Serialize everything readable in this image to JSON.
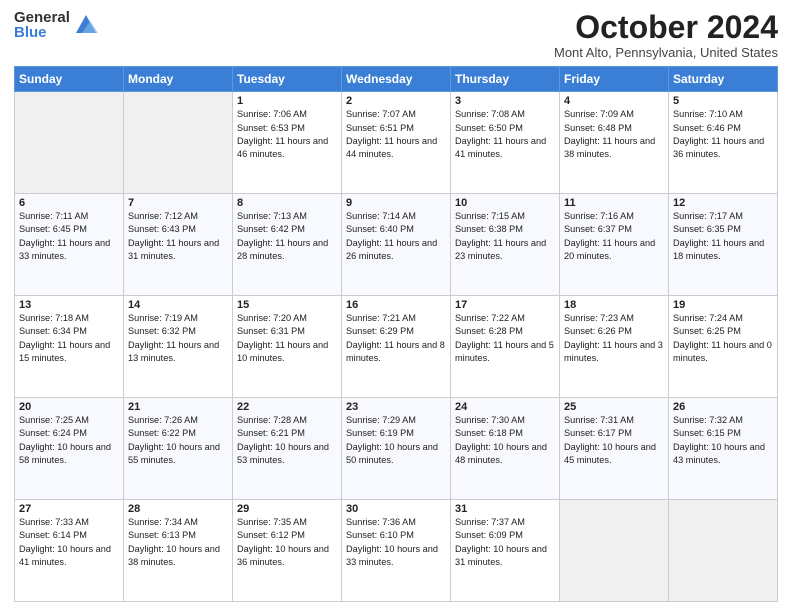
{
  "header": {
    "logo_general": "General",
    "logo_blue": "Blue",
    "month_title": "October 2024",
    "location": "Mont Alto, Pennsylvania, United States"
  },
  "weekdays": [
    "Sunday",
    "Monday",
    "Tuesday",
    "Wednesday",
    "Thursday",
    "Friday",
    "Saturday"
  ],
  "weeks": [
    [
      {
        "day": "",
        "info": ""
      },
      {
        "day": "",
        "info": ""
      },
      {
        "day": "1",
        "info": "Sunrise: 7:06 AM\nSunset: 6:53 PM\nDaylight: 11 hours and 46 minutes."
      },
      {
        "day": "2",
        "info": "Sunrise: 7:07 AM\nSunset: 6:51 PM\nDaylight: 11 hours and 44 minutes."
      },
      {
        "day": "3",
        "info": "Sunrise: 7:08 AM\nSunset: 6:50 PM\nDaylight: 11 hours and 41 minutes."
      },
      {
        "day": "4",
        "info": "Sunrise: 7:09 AM\nSunset: 6:48 PM\nDaylight: 11 hours and 38 minutes."
      },
      {
        "day": "5",
        "info": "Sunrise: 7:10 AM\nSunset: 6:46 PM\nDaylight: 11 hours and 36 minutes."
      }
    ],
    [
      {
        "day": "6",
        "info": "Sunrise: 7:11 AM\nSunset: 6:45 PM\nDaylight: 11 hours and 33 minutes."
      },
      {
        "day": "7",
        "info": "Sunrise: 7:12 AM\nSunset: 6:43 PM\nDaylight: 11 hours and 31 minutes."
      },
      {
        "day": "8",
        "info": "Sunrise: 7:13 AM\nSunset: 6:42 PM\nDaylight: 11 hours and 28 minutes."
      },
      {
        "day": "9",
        "info": "Sunrise: 7:14 AM\nSunset: 6:40 PM\nDaylight: 11 hours and 26 minutes."
      },
      {
        "day": "10",
        "info": "Sunrise: 7:15 AM\nSunset: 6:38 PM\nDaylight: 11 hours and 23 minutes."
      },
      {
        "day": "11",
        "info": "Sunrise: 7:16 AM\nSunset: 6:37 PM\nDaylight: 11 hours and 20 minutes."
      },
      {
        "day": "12",
        "info": "Sunrise: 7:17 AM\nSunset: 6:35 PM\nDaylight: 11 hours and 18 minutes."
      }
    ],
    [
      {
        "day": "13",
        "info": "Sunrise: 7:18 AM\nSunset: 6:34 PM\nDaylight: 11 hours and 15 minutes."
      },
      {
        "day": "14",
        "info": "Sunrise: 7:19 AM\nSunset: 6:32 PM\nDaylight: 11 hours and 13 minutes."
      },
      {
        "day": "15",
        "info": "Sunrise: 7:20 AM\nSunset: 6:31 PM\nDaylight: 11 hours and 10 minutes."
      },
      {
        "day": "16",
        "info": "Sunrise: 7:21 AM\nSunset: 6:29 PM\nDaylight: 11 hours and 8 minutes."
      },
      {
        "day": "17",
        "info": "Sunrise: 7:22 AM\nSunset: 6:28 PM\nDaylight: 11 hours and 5 minutes."
      },
      {
        "day": "18",
        "info": "Sunrise: 7:23 AM\nSunset: 6:26 PM\nDaylight: 11 hours and 3 minutes."
      },
      {
        "day": "19",
        "info": "Sunrise: 7:24 AM\nSunset: 6:25 PM\nDaylight: 11 hours and 0 minutes."
      }
    ],
    [
      {
        "day": "20",
        "info": "Sunrise: 7:25 AM\nSunset: 6:24 PM\nDaylight: 10 hours and 58 minutes."
      },
      {
        "day": "21",
        "info": "Sunrise: 7:26 AM\nSunset: 6:22 PM\nDaylight: 10 hours and 55 minutes."
      },
      {
        "day": "22",
        "info": "Sunrise: 7:28 AM\nSunset: 6:21 PM\nDaylight: 10 hours and 53 minutes."
      },
      {
        "day": "23",
        "info": "Sunrise: 7:29 AM\nSunset: 6:19 PM\nDaylight: 10 hours and 50 minutes."
      },
      {
        "day": "24",
        "info": "Sunrise: 7:30 AM\nSunset: 6:18 PM\nDaylight: 10 hours and 48 minutes."
      },
      {
        "day": "25",
        "info": "Sunrise: 7:31 AM\nSunset: 6:17 PM\nDaylight: 10 hours and 45 minutes."
      },
      {
        "day": "26",
        "info": "Sunrise: 7:32 AM\nSunset: 6:15 PM\nDaylight: 10 hours and 43 minutes."
      }
    ],
    [
      {
        "day": "27",
        "info": "Sunrise: 7:33 AM\nSunset: 6:14 PM\nDaylight: 10 hours and 41 minutes."
      },
      {
        "day": "28",
        "info": "Sunrise: 7:34 AM\nSunset: 6:13 PM\nDaylight: 10 hours and 38 minutes."
      },
      {
        "day": "29",
        "info": "Sunrise: 7:35 AM\nSunset: 6:12 PM\nDaylight: 10 hours and 36 minutes."
      },
      {
        "day": "30",
        "info": "Sunrise: 7:36 AM\nSunset: 6:10 PM\nDaylight: 10 hours and 33 minutes."
      },
      {
        "day": "31",
        "info": "Sunrise: 7:37 AM\nSunset: 6:09 PM\nDaylight: 10 hours and 31 minutes."
      },
      {
        "day": "",
        "info": ""
      },
      {
        "day": "",
        "info": ""
      }
    ]
  ]
}
